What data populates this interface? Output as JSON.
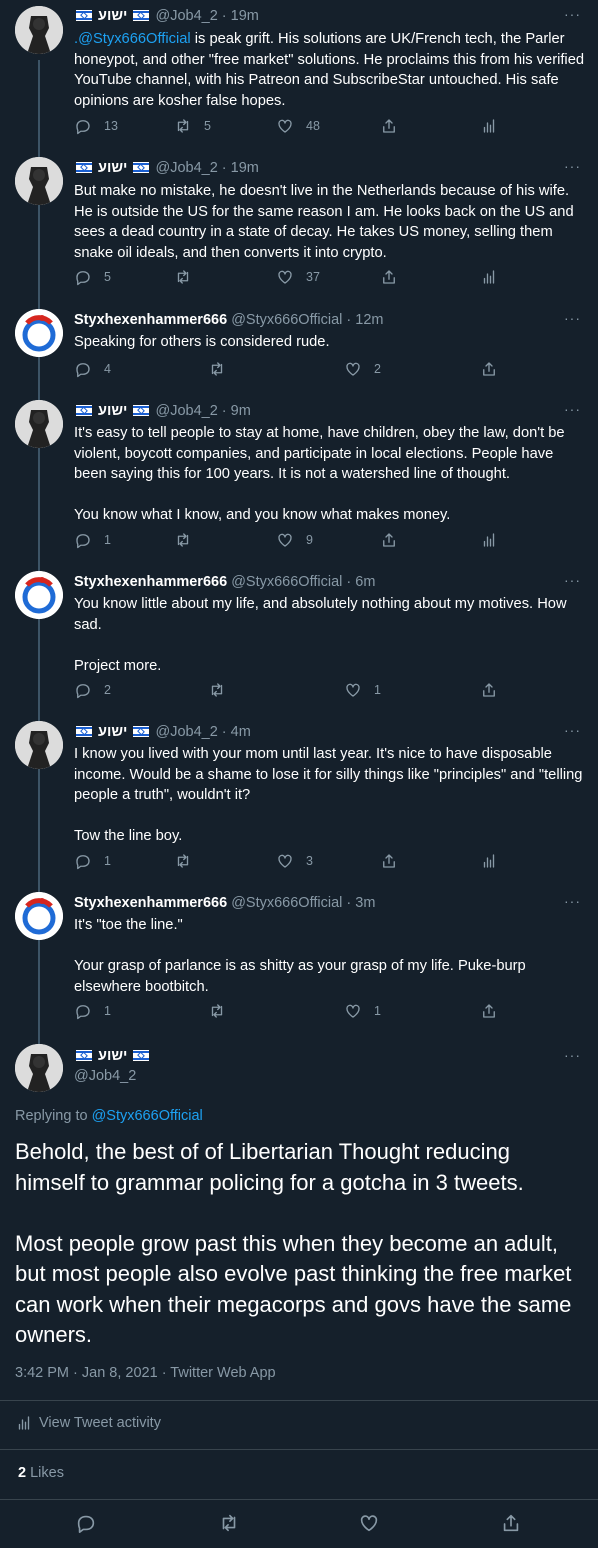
{
  "tweets": [
    {
      "author": "ישוע",
      "handle": "@Job4_2",
      "time": "19m",
      "mention": ".@Styx666Official",
      "text": " is peak grift. His solutions are UK/French tech, the Parler honeypot, and other \"free market\" solutions. He proclaims this from his verified YouTube channel, with his Patreon and SubscribeStar untouched. His safe opinions are kosher false hopes.",
      "replies": "13",
      "retweets": "5",
      "likes": "48"
    },
    {
      "author": "ישוע",
      "handle": "@Job4_2",
      "time": "19m",
      "text": "But make no mistake, he doesn't live in the Netherlands because of his wife. He is outside the US for the same reason I am. He looks back on the US and sees a dead country in a state of decay. He takes US money, selling them snake oil ideals, and then converts it into crypto.",
      "replies": "5",
      "retweets": "",
      "likes": "37"
    },
    {
      "author": "Styxhexenhammer666",
      "handle": "@Styx666Official",
      "time": "12m",
      "text": "Speaking for others is considered rude.",
      "replies": "4",
      "retweets": "",
      "likes": "2"
    },
    {
      "author": "ישוע",
      "handle": "@Job4_2",
      "time": "9m",
      "text": "It's easy to tell people to stay at home, have children, obey the law, don't be violent, boycott companies, and participate in local elections. People have been saying this for 100 years. It is not a watershed line of thought.\n\nYou know what I know, and you know what makes money.",
      "replies": "1",
      "retweets": "",
      "likes": "9"
    },
    {
      "author": "Styxhexenhammer666",
      "handle": "@Styx666Official",
      "time": "6m",
      "text": "You know little about my life, and absolutely nothing about my motives. How sad.\n\nProject more.",
      "replies": "2",
      "retweets": "",
      "likes": "1"
    },
    {
      "author": "ישוע",
      "handle": "@Job4_2",
      "time": "4m",
      "text": "I know you lived with your mom until last year. It's nice to have disposable income. Would be a shame to lose it for silly things like \"principles\" and \"telling people a truth\", wouldn't it?\n\nTow the line boy.",
      "replies": "1",
      "retweets": "",
      "likes": "3"
    },
    {
      "author": "Styxhexenhammer666",
      "handle": "@Styx666Official",
      "time": "3m",
      "text": "It's \"toe the line.\"\n\nYour grasp of parlance is as shitty as your grasp of my life. Puke-burp elsewhere bootbitch.",
      "replies": "1",
      "retweets": "",
      "likes": "1"
    }
  ],
  "focused": {
    "author": "ישוע",
    "handle": "@Job4_2",
    "replying_prefix": "Replying to ",
    "replying_to": "@Styx666Official",
    "text": "Behold, the best of of Libertarian Thought reducing himself to grammar policing for a gotcha in 3 tweets.\n\nMost people grow past this when they become an adult, but most people also evolve past thinking the free market can work when their megacorps and govs have the same owners.",
    "timestamp": "3:42 PM · Jan 8, 2021 · Twitter Web App",
    "activity_label": "View Tweet activity",
    "likes_count": "2",
    "likes_label": "Likes"
  },
  "colors": {
    "background": "#15202b",
    "accent": "#1da1f2",
    "muted": "#8899a6",
    "divider": "#38444d"
  },
  "more_icon": "···"
}
